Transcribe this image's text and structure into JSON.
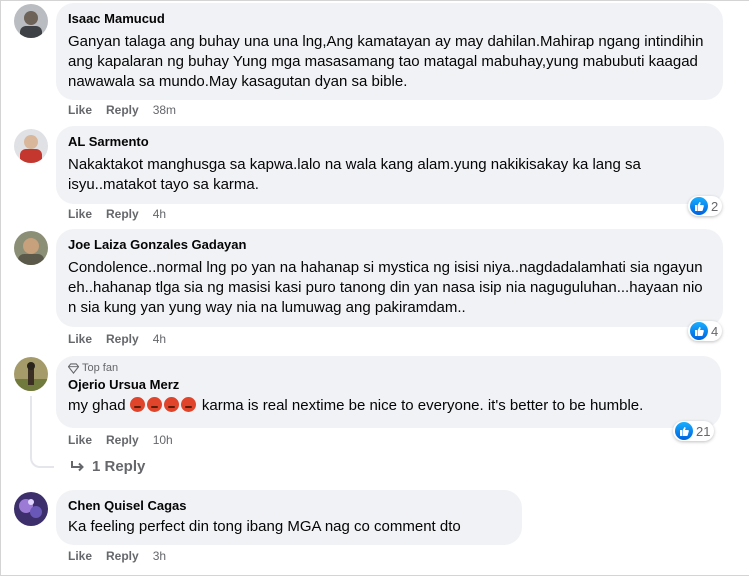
{
  "comments": [
    {
      "author": "Isaac Mamucud",
      "text": "Ganyan talaga ang buhay una una lng,Ang kamatayan ay may dahilan.Mahirap ngang intindihin ang kapalaran ng buhay Yung mga masasamang tao matagal mabuhay,yung mabubuti kaagad nawawala sa mundo.May kasagutan dyan sa bible.",
      "like": "Like",
      "reply": "Reply",
      "time": "38m"
    },
    {
      "author": "AL Sarmento",
      "text": "Nakaktakot manghusga sa kapwa.lalo na wala kang alam.yung nakikisakay ka lang sa isyu..matakot tayo sa karma.",
      "like": "Like",
      "reply": "Reply",
      "time": "4h",
      "reactions": "2"
    },
    {
      "author": "Joe Laiza Gonzales Gadayan",
      "text": "Condolence..normal lng po yan na hahanap si mystica ng isisi niya..nagdadalamhati sia ngayun eh..hahanap tlga sia ng masisi kasi puro tanong din yan nasa isip nia naguguluhan...hayaan nio n sia kung yan yung way nia na lumuwag ang pakiramdam..",
      "like": "Like",
      "reply": "Reply",
      "time": "4h",
      "reactions": "4"
    },
    {
      "badge": "Top fan",
      "author": "Ojerio Ursua Merz",
      "text_before": "my ghad",
      "text_after": " karma is real nextime be nice to everyone. it's better to be humble.",
      "like": "Like",
      "reply": "Reply",
      "time": "10h",
      "reactions": "21",
      "replies_link": "1 Reply"
    },
    {
      "author": "Chen Quisel Cagas",
      "text": "Ka feeling perfect din tong ibang MGA nag co comment dto",
      "like": "Like",
      "reply": "Reply",
      "time": "3h"
    }
  ],
  "colors": {
    "bubble": "#f0f2f5",
    "meta": "#65676b",
    "like_blue": "#0062df"
  }
}
